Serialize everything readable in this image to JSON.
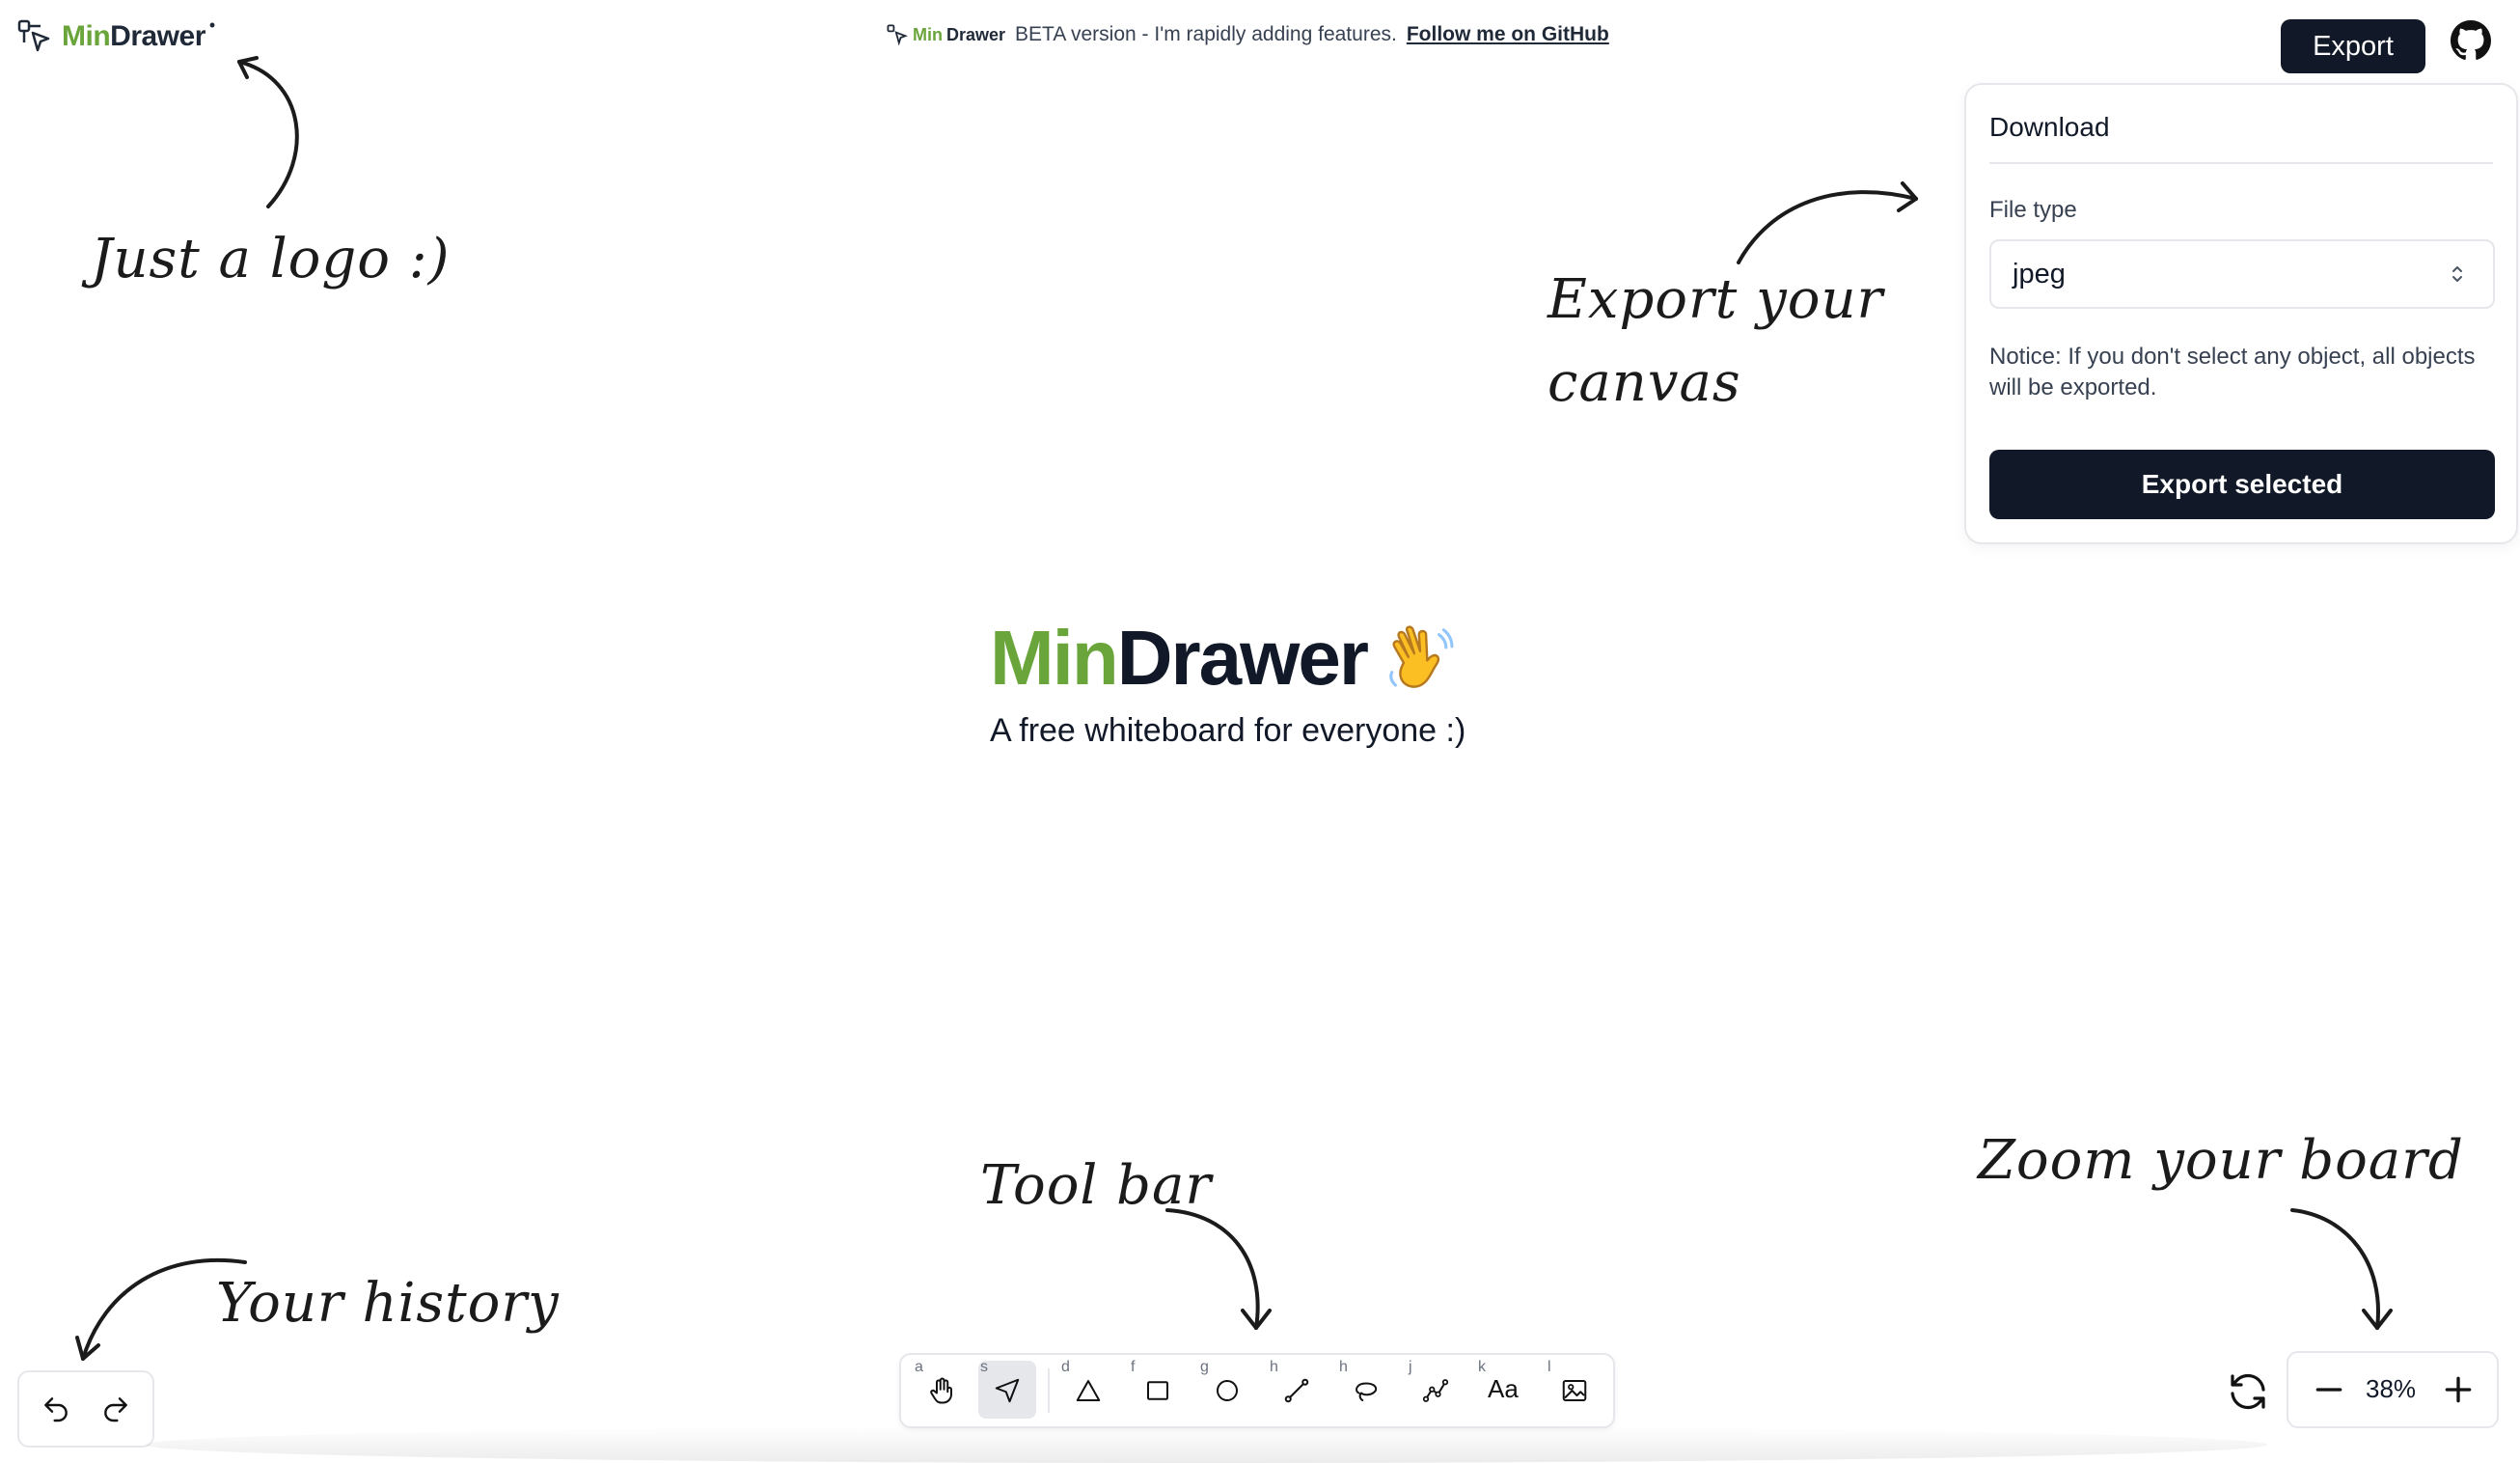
{
  "app": {
    "logo_min": "Min",
    "logo_drawer": "Drawer",
    "logo_mark": "•"
  },
  "banner": {
    "logo_min": "Min",
    "logo_drawer": "Drawer",
    "text": "BETA version - I'm rapidly adding features.",
    "link": "Follow me on GitHub"
  },
  "header": {
    "export_label": "Export",
    "github_icon": "github-icon"
  },
  "export_panel": {
    "title": "Download",
    "file_type_label": "File type",
    "file_type_value": "jpeg",
    "notice": "Notice: If you don't select any object, all objects will be exported.",
    "button_label": "Export selected"
  },
  "hints": {
    "logo": "Just a logo :)",
    "export_line1": "Export your",
    "export_line2": "canvas",
    "toolbar": "Tool bar",
    "zoom": "Zoom your board",
    "history": "Your history"
  },
  "hero": {
    "title_min": "Min",
    "title_drawer": "Drawer",
    "subtitle": "A free whiteboard for everyone :)"
  },
  "toolbar": {
    "tools": [
      {
        "key": "a",
        "icon": "hand-icon"
      },
      {
        "key": "s",
        "icon": "pointer-icon"
      },
      {
        "key": "d",
        "icon": "triangle-icon"
      },
      {
        "key": "f",
        "icon": "rectangle-icon"
      },
      {
        "key": "g",
        "icon": "circle-icon"
      },
      {
        "key": "h",
        "icon": "line-icon"
      },
      {
        "key": "h",
        "icon": "lasso-icon"
      },
      {
        "key": "j",
        "icon": "polyline-icon"
      },
      {
        "key": "k",
        "icon": "text-icon",
        "label": "Aa"
      },
      {
        "key": "l",
        "icon": "image-icon"
      }
    ]
  },
  "zoom": {
    "value": "38%"
  }
}
